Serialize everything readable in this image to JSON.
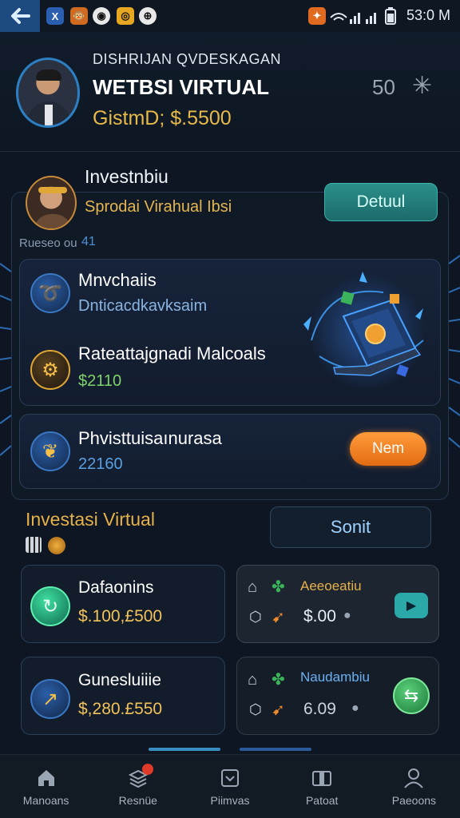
{
  "status_bar": {
    "time": "53:0 M",
    "apps": [
      "X",
      "🐵",
      "◉",
      "◎",
      "⊕"
    ]
  },
  "header": {
    "subtitle": "DISHRIJAN QVDESKAGAN",
    "title": "WETBSI VIRTUAL",
    "balance": "GistmD; $.5500",
    "count": "50"
  },
  "investor": {
    "title": "Investnbiu",
    "subtitle": "Sprodai Virahual Ibsi",
    "detail_button": "Detuul",
    "small_label": "Rueseo ou",
    "small_num": "41"
  },
  "card1": {
    "row1_title": "Mnvchaiis",
    "row1_sub": "Dnticacdkavksaim",
    "row2_title": "Rateattajgnadi Malcoals",
    "row2_value": "$2110"
  },
  "card2": {
    "title": "Phvisttuisaınurasa",
    "value": "22160",
    "button": "Nem"
  },
  "section": {
    "title": "Investasi Virtual",
    "sort_button": "Sonit"
  },
  "tiles": [
    {
      "title": "Dafaonins",
      "amount": "$.100,£500"
    },
    {
      "title": "Gunesluiiie",
      "amount": "$,280.£550"
    }
  ],
  "right_tiles": [
    {
      "title": "Aeeoeatiu",
      "value": "$.00",
      "action": "play"
    },
    {
      "title": "Naudambiu",
      "value": "6.09",
      "action": "swap"
    }
  ],
  "bottom_nav": [
    {
      "label": "Manoans",
      "icon": "home-icon"
    },
    {
      "label": "Resnüe",
      "icon": "stack-icon"
    },
    {
      "label": "Piimvas",
      "icon": "box-icon"
    },
    {
      "label": "Patoat",
      "icon": "wallet-icon"
    },
    {
      "label": "Paeoons",
      "icon": "profile-icon"
    }
  ],
  "colors": {
    "accent_gold": "#e6b04a",
    "accent_teal": "#2a8f8a",
    "accent_orange": "#f28a2a",
    "background": "#0d1622"
  }
}
